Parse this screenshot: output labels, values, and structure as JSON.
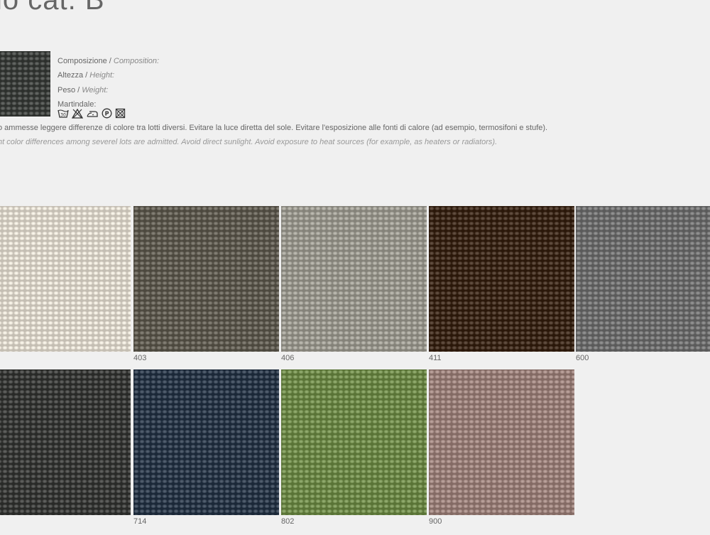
{
  "page": {
    "title": "io cat. B"
  },
  "specs": {
    "composition": {
      "it": "Composizione / ",
      "en": "Composition:"
    },
    "height": {
      "it": "Altezza / ",
      "en": "Height:"
    },
    "weight": {
      "it": "Peso / ",
      "en": "Weight:"
    },
    "martindale": {
      "it": "Martindale:"
    }
  },
  "care_icons": [
    "wash-30-icon",
    "no-bleach-icon",
    "iron-low-icon",
    "dry-clean-p-icon",
    "no-tumble-dry-icon"
  ],
  "notes": {
    "it": "o ammesse leggere differenze di colore tra lotti diversi. Evitare la luce diretta del sole. Evitare l'esposizione alle fonti di calore (ad esempio, termosifoni e stufe).",
    "en": "ht color differences among severel lots are admitted. Avoid direct sunlight. Avoid exposure to heat sources (for example, as heaters or radiators)."
  },
  "swatches": [
    {
      "code": "",
      "color": "#e7e1d6"
    },
    {
      "code": "403",
      "color": "#6f6b61"
    },
    {
      "code": "406",
      "color": "#a7a59c"
    },
    {
      "code": "411",
      "color": "#4d3a2c"
    },
    {
      "code": "600",
      "color": "#7d7d7d"
    },
    {
      "code": "",
      "color": "#4b4c4a"
    },
    {
      "code": "714",
      "color": "#3d4a5a"
    },
    {
      "code": "802",
      "color": "#7c9659"
    },
    {
      "code": "900",
      "color": "#a68d87"
    }
  ]
}
